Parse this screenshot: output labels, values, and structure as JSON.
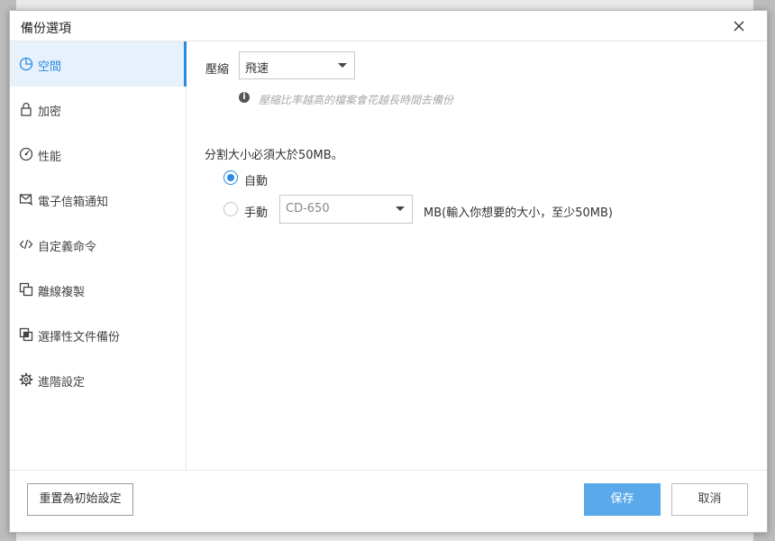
{
  "dialog": {
    "title": "備份選項"
  },
  "sidebar": {
    "items": [
      {
        "label": "空間",
        "icon": "pie-chart-icon",
        "active": true
      },
      {
        "label": "加密",
        "icon": "lock-icon",
        "active": false
      },
      {
        "label": "性能",
        "icon": "gauge-icon",
        "active": false
      },
      {
        "label": "電子信箱通知",
        "icon": "mail-icon",
        "active": false
      },
      {
        "label": "自定義命令",
        "icon": "code-icon",
        "active": false
      },
      {
        "label": "離線複製",
        "icon": "copy-icon",
        "active": false
      },
      {
        "label": "選擇性文件備份",
        "icon": "selective-copy-icon",
        "active": false
      },
      {
        "label": "進階設定",
        "icon": "gear-icon",
        "active": false
      }
    ]
  },
  "compression": {
    "label": "壓縮",
    "selected": "飛速",
    "hint": "壓縮比率越高的檔案會花越長時間去備份"
  },
  "split": {
    "heading": "分割大小必須大於50MB。",
    "auto_label": "自動",
    "manual_label": "手動",
    "auto_selected": true,
    "manual_selected": false,
    "size_selected": "CD-650",
    "size_note": "MB(輸入你想要的大小，至少50MB)"
  },
  "footer": {
    "reset_label": "重置為初始設定",
    "save_label": "保存",
    "cancel_label": "取消"
  },
  "colors": {
    "accent": "#2b8be0",
    "save_button": "#5aa9ea",
    "active_nav_bg": "#e6f1fb"
  }
}
